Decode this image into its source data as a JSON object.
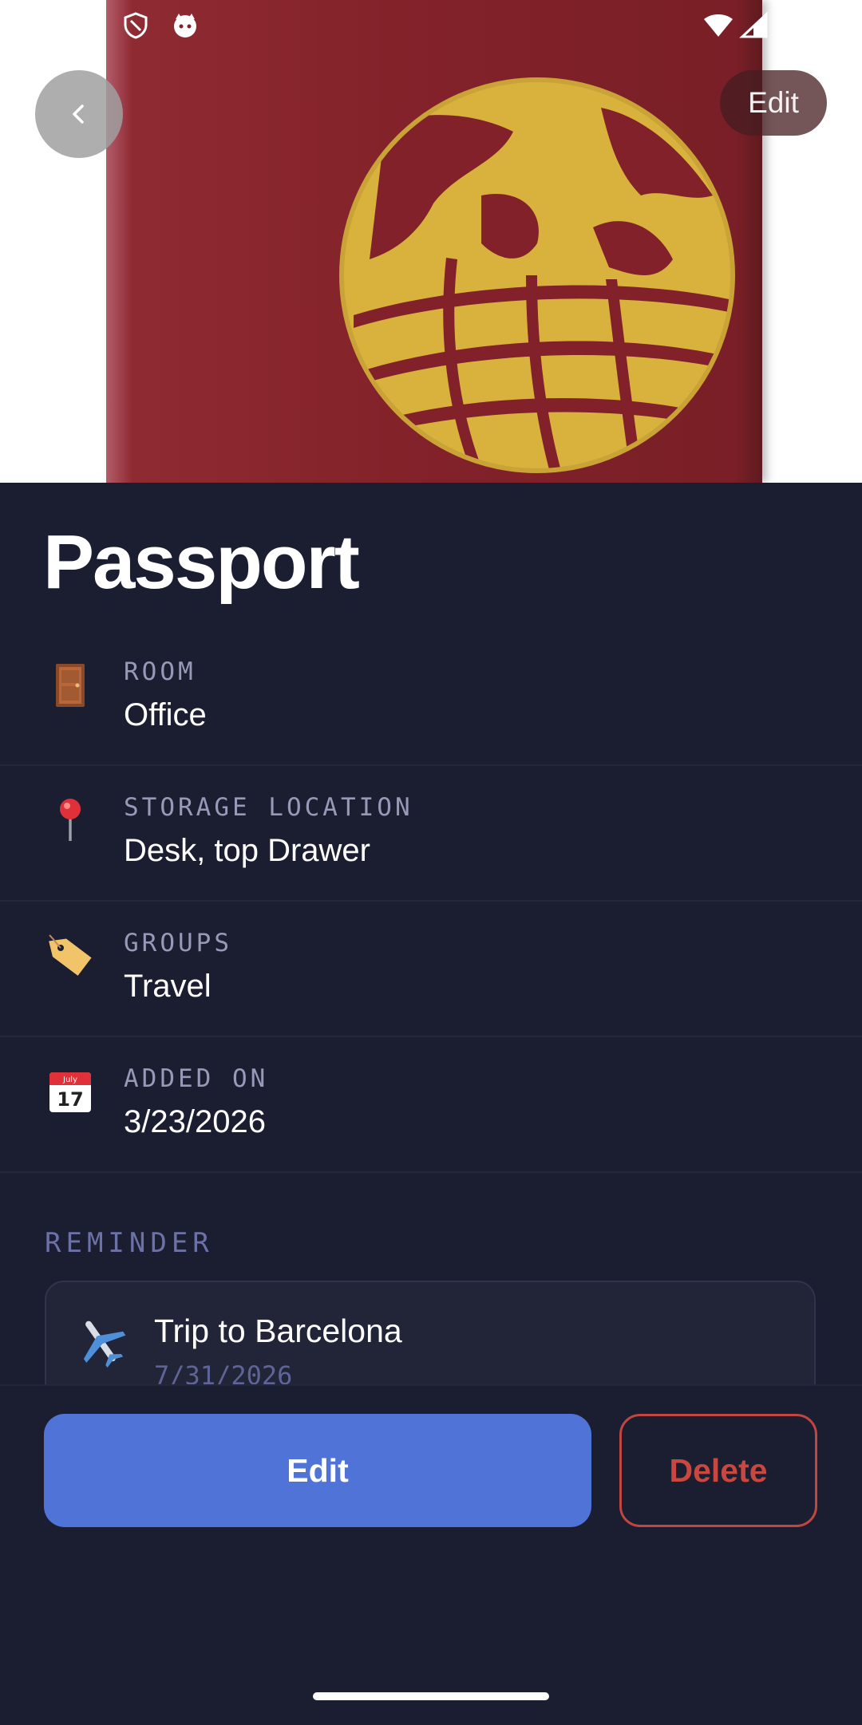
{
  "header": {
    "back_icon": "chevron-left-icon",
    "edit_label": "Edit",
    "image_alt": "passport cover photo"
  },
  "status_bar": {
    "left_icons": [
      "shield-icon",
      "cat-face-icon"
    ],
    "right_icons": [
      "wifi-icon",
      "cell-signal-icon"
    ]
  },
  "item": {
    "title": "Passport",
    "details": [
      {
        "icon": "door-icon",
        "label": "ROOM",
        "value": "Office"
      },
      {
        "icon": "pin-icon",
        "label": "STORAGE LOCATION",
        "value": "Desk, top Drawer"
      },
      {
        "icon": "tag-icon",
        "label": "GROUPS",
        "value": "Travel"
      },
      {
        "icon": "calendar-icon",
        "label": "ADDED ON",
        "value": "3/23/2026",
        "calendar_text": "July",
        "calendar_day": "17"
      }
    ]
  },
  "reminder": {
    "section_label": "REMINDER",
    "icon": "airplane-icon",
    "title": "Trip to Barcelona",
    "date": "7/31/2026"
  },
  "actions": {
    "edit_label": "Edit",
    "delete_label": "Delete"
  },
  "colors": {
    "background": "#1b1d30",
    "accent": "#4f73d6",
    "danger": "#c8473f",
    "label": "#9799b8"
  }
}
